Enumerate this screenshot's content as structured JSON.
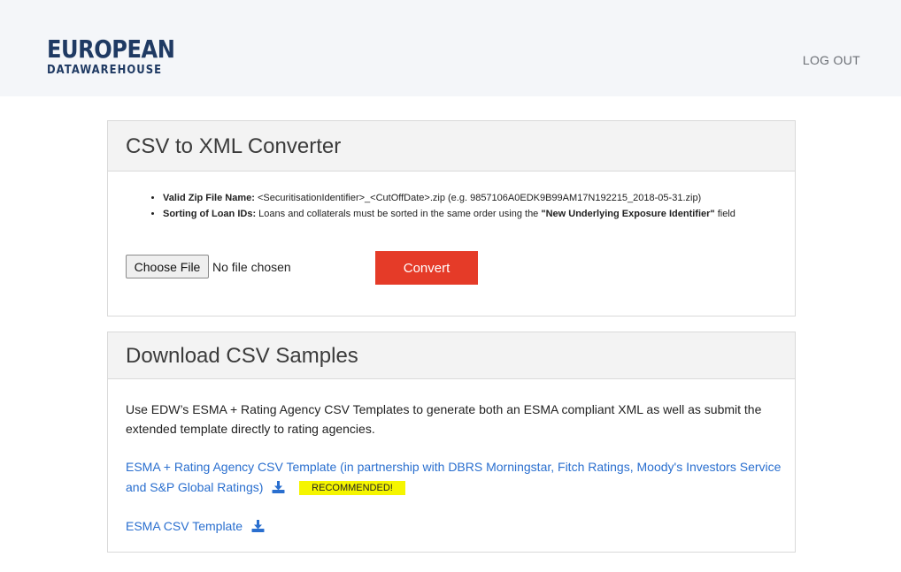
{
  "brand": {
    "line1": "EUROPEAN",
    "line2": "DATAWAREHOUSE",
    "color": "#1f3a63"
  },
  "header": {
    "logout_label": "LOG OUT"
  },
  "converter": {
    "title": "CSV to XML Converter",
    "rules": [
      {
        "label": "Valid Zip File Name:",
        "text": "<SecuritisationIdentifier>_<CutOffDate>.zip (e.g. 9857106A0EDK9B99AM17N192215_2018-05-31.zip)"
      },
      {
        "label": "Sorting of Loan IDs:",
        "text_before": "Loans and collaterals must be sorted in the same order using the",
        "emphasis": "\"New Underlying Exposure Identifier\"",
        "text_after": "field"
      }
    ],
    "choose_file_label": "Choose File",
    "file_status": "No file chosen",
    "convert_label": "Convert",
    "convert_color": "#e53b28"
  },
  "samples": {
    "title": "Download CSV Samples",
    "description": "Use EDW’s ESMA + Rating Agency CSV Templates to generate both an ESMA compliant XML as well as submit the extended template directly to rating agencies.",
    "links": [
      {
        "label": "ESMA + Rating Agency CSV Template (in partnership with DBRS Morningstar, Fitch Ratings, Moody's Investors Service and S&P Global Ratings)",
        "icon": "download-icon",
        "badge": "RECOMMENDED!"
      },
      {
        "label": "ESMA CSV Template",
        "icon": "download-icon"
      }
    ],
    "link_color": "#2a6fcf",
    "badge_color": "#f5f500"
  }
}
